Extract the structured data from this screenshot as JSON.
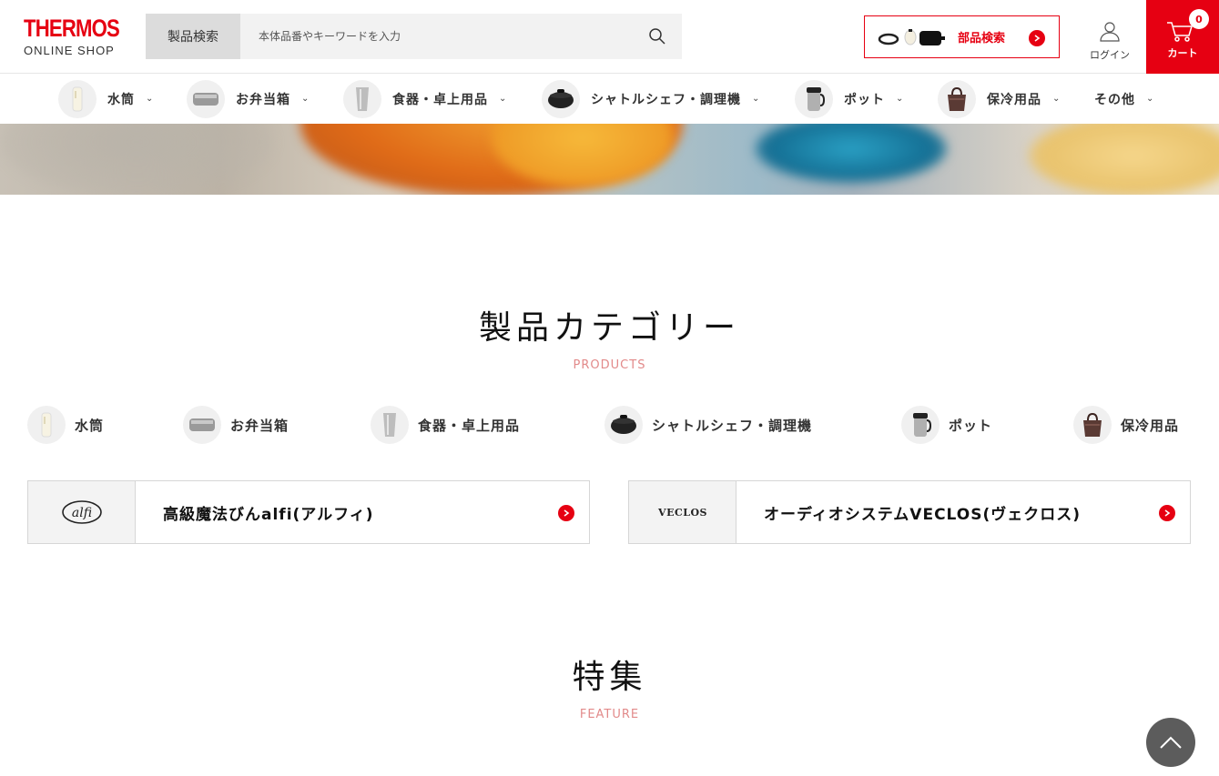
{
  "brand": {
    "logo_main": "THERMOS",
    "logo_sub": "ONLINE SHOP",
    "accent": "#e60012"
  },
  "search": {
    "label": "製品検索",
    "placeholder": "本体品番やキーワードを入力",
    "icon": "search-icon"
  },
  "parts_search": {
    "label": "部品検索"
  },
  "login": {
    "label": "ログイン",
    "icon": "user-icon"
  },
  "cart": {
    "count": "0",
    "label": "カート",
    "icon": "cart-icon"
  },
  "nav": {
    "items": [
      {
        "label": "水筒"
      },
      {
        "label": "お弁当箱"
      },
      {
        "label": "食器・卓上用品"
      },
      {
        "label": "シャトルシェフ・調理機"
      },
      {
        "label": "ポット"
      },
      {
        "label": "保冷用品"
      },
      {
        "label": "その他"
      }
    ]
  },
  "products": {
    "title": "製品カテゴリー",
    "subtitle": "PRODUCTS",
    "categories": [
      {
        "label": "水筒"
      },
      {
        "label": "お弁当箱"
      },
      {
        "label": "食器・卓上用品"
      },
      {
        "label": "シャトルシェフ・調理機"
      },
      {
        "label": "ポット"
      },
      {
        "label": "保冷用品"
      }
    ],
    "brands": [
      {
        "logo": "alfi",
        "label": "高級魔法びんalfi(アルフィ)"
      },
      {
        "logo": "VECLOS",
        "label": "オーディオシステムVECLOS(ヴェクロス)"
      }
    ]
  },
  "feature": {
    "title": "特集",
    "subtitle": "FEATURE"
  }
}
